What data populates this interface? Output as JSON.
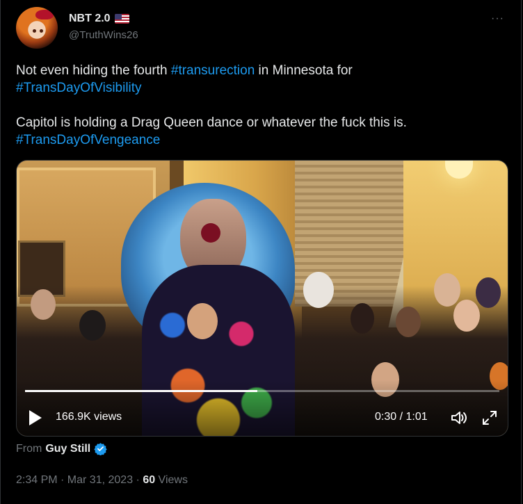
{
  "author": {
    "display_name": "NBT 2.0",
    "flag_icon": "us-flag-icon",
    "handle": "@TruthWins26"
  },
  "more_label": "···",
  "tweet": {
    "line1_prefix": "Not even hiding the fourth ",
    "line1_tag": "#transurection",
    "line1_suffix": " in Minnesota for",
    "line2_tag": "#TransDayOfVisibility",
    "line3": "Capitol is holding a Drag Queen dance or whatever the fuck this is.",
    "line4_tag": "#TransDayOfVengeance"
  },
  "video": {
    "views_label": "166.9K views",
    "time_label": "0:30 / 1:01",
    "progress": 0.49
  },
  "source": {
    "from_label": "From",
    "from_name": "Guy Still"
  },
  "meta": {
    "timestamp": "2:34 PM · Mar 31, 2023 · ",
    "views_count": "60",
    "views_label": " Views"
  },
  "colors": {
    "background": "#000000",
    "text": "#e7e9ea",
    "muted": "#71767b",
    "accent": "#1d9bf0"
  }
}
